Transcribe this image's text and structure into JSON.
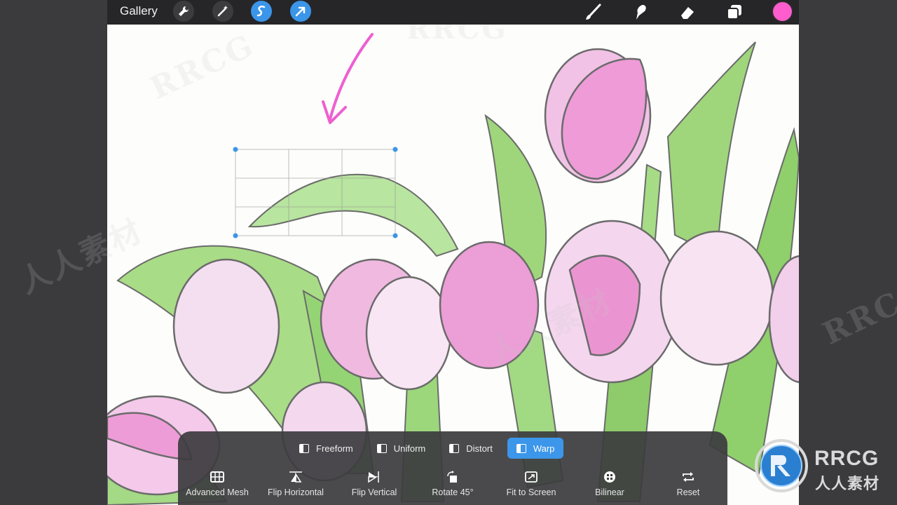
{
  "topbar": {
    "gallery_label": "Gallery",
    "left_tools": [
      "wrench-icon",
      "magic-wand-icon",
      "selection-icon",
      "transform-arrow-icon"
    ],
    "right_tools": [
      "brush-icon",
      "smudge-icon",
      "eraser-icon",
      "layers-icon"
    ],
    "current_color": "#ff5ccd"
  },
  "transform": {
    "modes": [
      {
        "label": "Freeform",
        "active": false
      },
      {
        "label": "Uniform",
        "active": false
      },
      {
        "label": "Distort",
        "active": false
      },
      {
        "label": "Warp",
        "active": true
      }
    ],
    "actions": [
      {
        "label": "Advanced Mesh",
        "icon": "mesh-icon"
      },
      {
        "label": "Flip Horizontal",
        "icon": "flip-horizontal-icon"
      },
      {
        "label": "Flip Vertical",
        "icon": "flip-vertical-icon"
      },
      {
        "label": "Rotate 45°",
        "icon": "rotate-icon"
      },
      {
        "label": "Fit to Screen",
        "icon": "fit-screen-icon"
      },
      {
        "label": "Bilinear",
        "icon": "bilinear-icon"
      },
      {
        "label": "Reset",
        "icon": "reset-icon"
      }
    ]
  },
  "watermark": {
    "text_en": "RRCG",
    "text_cn": "人人素材"
  },
  "accent_color": "#3b95e8"
}
